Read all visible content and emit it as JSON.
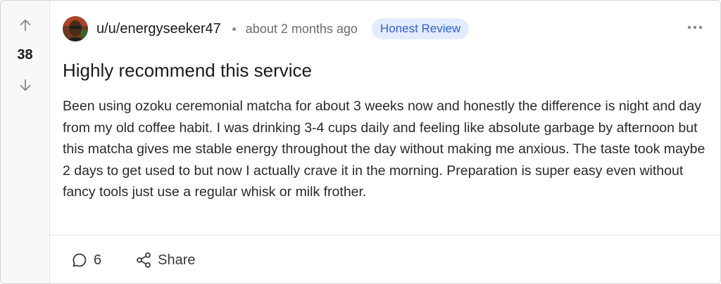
{
  "post": {
    "votes": "38",
    "author": "u/u/energyseeker47",
    "timestamp": "about 2 months ago",
    "flair": "Honest Review",
    "title": "Highly recommend this service",
    "body": "Been using ozoku ceremonial matcha for about 3 weeks now and honestly the difference is night and day from my old coffee habit. I was drinking 3-4 cups daily and feeling like absolute garbage by afternoon but this matcha gives me stable energy throughout the day without making me anxious. The taste took maybe 2 days to get used to but now I actually crave it in the morning. Preparation is super easy even without fancy tools just use a regular whisk or milk frother.",
    "comments_count": "6",
    "share_label": "Share"
  },
  "icons": {
    "upvote": "arrow-up-icon",
    "downvote": "arrow-down-icon",
    "more": "more-horizontal-icon",
    "comment": "comment-bubble-icon",
    "share": "share-nodes-icon"
  },
  "colors": {
    "flair_bg": "#e3ecff",
    "flair_text": "#2f5fd0",
    "vote_rail_bg": "#f8f8f8",
    "border": "#d6d6d6"
  }
}
